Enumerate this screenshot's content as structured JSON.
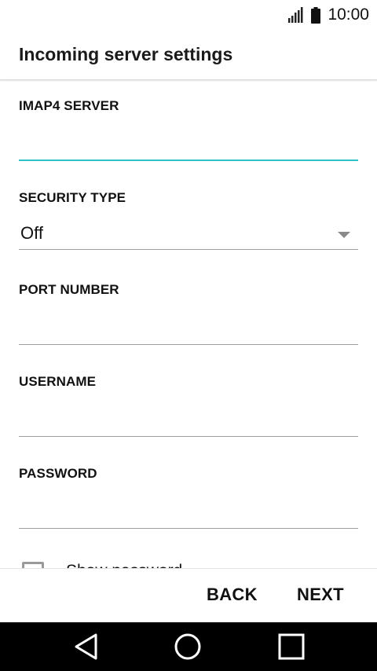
{
  "status_bar": {
    "time": "10:00",
    "icons": [
      "signal-icon",
      "battery-icon"
    ]
  },
  "header": {
    "title": "Incoming server settings"
  },
  "form": {
    "server": {
      "label": "IMAP4 SERVER",
      "value": ""
    },
    "security": {
      "label": "SECURITY TYPE",
      "value": "Off"
    },
    "port": {
      "label": "PORT NUMBER",
      "value": ""
    },
    "username": {
      "label": "USERNAME",
      "value": ""
    },
    "password": {
      "label": "PASSWORD",
      "value": ""
    },
    "show_password": {
      "label": "Show password",
      "checked": false
    }
  },
  "actions": {
    "back_label": "BACK",
    "next_label": "NEXT"
  },
  "nav": {
    "icons": [
      "back-triangle-icon",
      "home-circle-icon",
      "recents-square-icon"
    ]
  },
  "colors": {
    "accent": "#2bc2c8",
    "divider": "#9e9e9e",
    "nav_bar": "#000000"
  }
}
